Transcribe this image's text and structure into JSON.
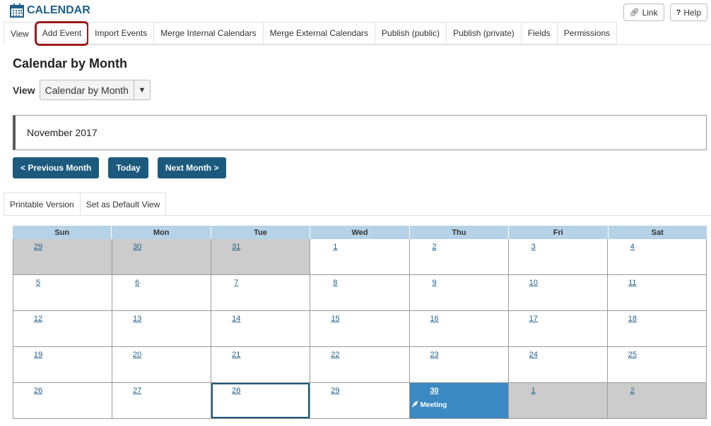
{
  "header": {
    "title": "CALENDAR",
    "link_label": "Link",
    "help_label": "Help"
  },
  "tabs": [
    "View",
    "Add Event",
    "Import Events",
    "Merge Internal Calendars",
    "Merge External Calendars",
    "Publish (public)",
    "Publish (private)",
    "Fields",
    "Permissions"
  ],
  "page_title": "Calendar by Month",
  "view": {
    "label": "View",
    "selected": "Calendar by Month"
  },
  "month_label": "November 2017",
  "nav": {
    "prev": "< Previous Month",
    "today": "Today",
    "next": "Next Month >"
  },
  "subtabs": [
    "Printable Version",
    "Set as Default View"
  ],
  "calendar": {
    "day_names": [
      "Sun",
      "Mon",
      "Tue",
      "Wed",
      "Thu",
      "Fri",
      "Sat"
    ],
    "weeks": [
      [
        "29",
        "30",
        "31",
        "1",
        "2",
        "3",
        "4"
      ],
      [
        "5",
        "6",
        "7",
        "8",
        "9",
        "10",
        "11"
      ],
      [
        "12",
        "13",
        "14",
        "15",
        "16",
        "17",
        "18"
      ],
      [
        "19",
        "20",
        "21",
        "22",
        "23",
        "24",
        "25"
      ],
      [
        "26",
        "27",
        "28",
        "29",
        "30",
        "1",
        "2"
      ]
    ],
    "event": {
      "title": "Meeting"
    }
  },
  "colors": {
    "accent": "#1b5a7c",
    "header_bg": "#b6d2e6",
    "event_bg": "#3b89c3",
    "other_month_bg": "#cccccc",
    "highlight": "#9b1c1c"
  }
}
